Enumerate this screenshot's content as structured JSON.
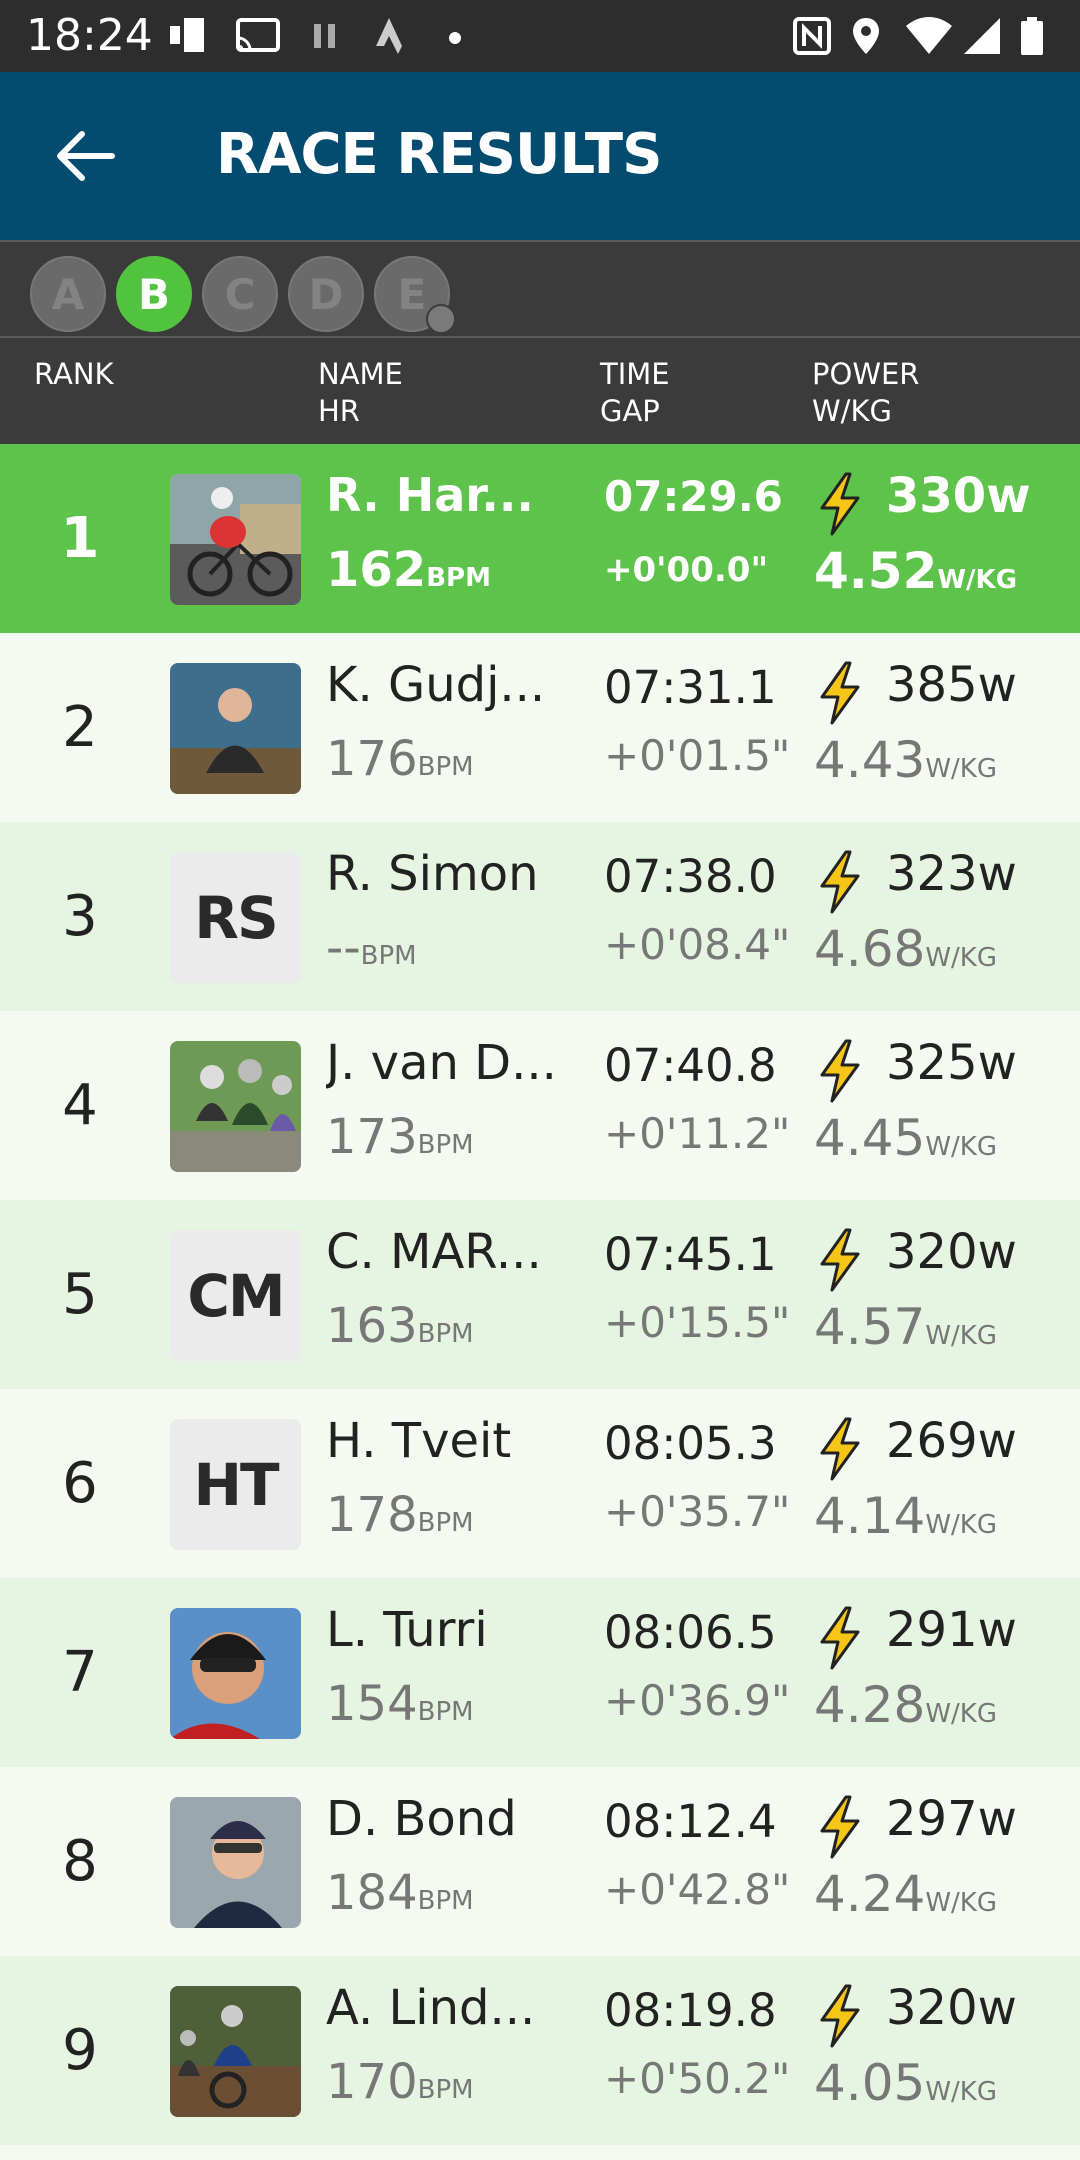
{
  "status_bar": {
    "time": "18:24"
  },
  "header": {
    "title": "RACE RESULTS"
  },
  "categories": [
    {
      "label": "A",
      "active": false
    },
    {
      "label": "B",
      "active": true
    },
    {
      "label": "C",
      "active": false
    },
    {
      "label": "D",
      "active": false
    },
    {
      "label": "E",
      "active": false
    }
  ],
  "columns": {
    "rank": "RANK",
    "name": "NAME",
    "hr": "HR",
    "time": "TIME",
    "gap": "GAP",
    "power": "POWER",
    "wkg": "W/KG"
  },
  "units": {
    "bpm": "BPM",
    "wkg": "W/KG"
  },
  "results": [
    {
      "rank": "1",
      "name": "R. Har...",
      "hr": "162",
      "time": "07:29.6",
      "gap": "+0'00.0\"",
      "watts": "330w",
      "wkg": "4.52",
      "avatar": "photo"
    },
    {
      "rank": "2",
      "name": "K. Gudj...",
      "hr": "176",
      "time": "07:31.1",
      "gap": "+0'01.5\"",
      "watts": "385w",
      "wkg": "4.43",
      "avatar": "photo"
    },
    {
      "rank": "3",
      "name": "R. Simon",
      "hr": "--",
      "time": "07:38.0",
      "gap": "+0'08.4\"",
      "watts": "323w",
      "wkg": "4.68",
      "avatar": "initials",
      "initials": "RS"
    },
    {
      "rank": "4",
      "name": "J. van D...",
      "hr": "173",
      "time": "07:40.8",
      "gap": "+0'11.2\"",
      "watts": "325w",
      "wkg": "4.45",
      "avatar": "photo"
    },
    {
      "rank": "5",
      "name": "C. MAR...",
      "hr": "163",
      "time": "07:45.1",
      "gap": "+0'15.5\"",
      "watts": "320w",
      "wkg": "4.57",
      "avatar": "initials",
      "initials": "CM"
    },
    {
      "rank": "6",
      "name": "H. Tveit",
      "hr": "178",
      "time": "08:05.3",
      "gap": "+0'35.7\"",
      "watts": "269w",
      "wkg": "4.14",
      "avatar": "initials",
      "initials": "HT"
    },
    {
      "rank": "7",
      "name": "L. Turri",
      "hr": "154",
      "time": "08:06.5",
      "gap": "+0'36.9\"",
      "watts": "291w",
      "wkg": "4.28",
      "avatar": "photo"
    },
    {
      "rank": "8",
      "name": "D. Bond",
      "hr": "184",
      "time": "08:12.4",
      "gap": "+0'42.8\"",
      "watts": "297w",
      "wkg": "4.24",
      "avatar": "photo"
    },
    {
      "rank": "9",
      "name": "A. Lind...",
      "hr": "170",
      "time": "08:19.8",
      "gap": "+0'50.2\"",
      "watts": "320w",
      "wkg": "4.05",
      "avatar": "photo"
    }
  ],
  "colors": {
    "leader": "#5ec34a",
    "app_bar": "#034b6f",
    "active_category": "#52c33f",
    "bolt": "#f5c518"
  }
}
